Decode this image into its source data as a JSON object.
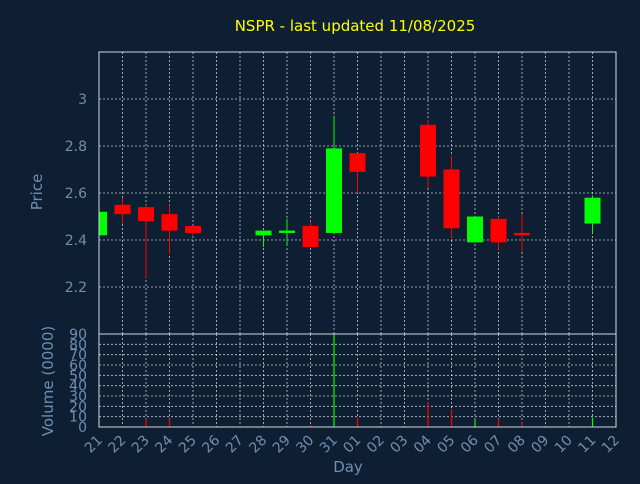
{
  "chart_data": {
    "type": "candlestick",
    "title": "NSPR - last updated 11/08/2025",
    "xlabel": "Day",
    "ylabel_price": "Price",
    "ylabel_volume": "Volume (0000)",
    "x_ticks": [
      "21",
      "22",
      "23",
      "24",
      "25",
      "26",
      "27",
      "28",
      "29",
      "30",
      "31",
      "01",
      "02",
      "03",
      "04",
      "05",
      "06",
      "07",
      "08",
      "09",
      "10",
      "11",
      "12"
    ],
    "price_ylim": [
      2.0,
      3.2
    ],
    "price_yticks": [
      2.2,
      2.4,
      2.6,
      2.8,
      3
    ],
    "volume_ylim": [
      0,
      90
    ],
    "volume_yticks": [
      0,
      10,
      20,
      30,
      40,
      50,
      60,
      70,
      80,
      90
    ],
    "grid": true,
    "colors": {
      "up": "#00ff00",
      "down": "#ff0000",
      "title": "#ffff00",
      "axis_text": "#6e8fb0",
      "grid": "#ffffff",
      "background": "#0f1f33"
    },
    "candles": [
      {
        "day": "21",
        "open": 2.42,
        "high": 2.52,
        "low": 2.42,
        "close": 2.52,
        "volume": 0
      },
      {
        "day": "22",
        "open": 2.55,
        "high": 2.58,
        "low": 2.47,
        "close": 2.51,
        "volume": 1
      },
      {
        "day": "23",
        "open": 2.54,
        "high": 2.55,
        "low": 2.24,
        "close": 2.48,
        "volume": 8
      },
      {
        "day": "24",
        "open": 2.51,
        "high": 2.55,
        "low": 2.34,
        "close": 2.44,
        "volume": 8
      },
      {
        "day": "25",
        "open": 2.46,
        "high": 2.46,
        "low": 2.42,
        "close": 2.43,
        "volume": 1
      },
      {
        "day": "28",
        "open": 2.42,
        "high": 2.44,
        "low": 2.37,
        "close": 2.44,
        "volume": 1
      },
      {
        "day": "29",
        "open": 2.43,
        "high": 2.49,
        "low": 2.38,
        "close": 2.44,
        "volume": 1
      },
      {
        "day": "30",
        "open": 2.46,
        "high": 2.48,
        "low": 2.37,
        "close": 2.37,
        "volume": 2
      },
      {
        "day": "31",
        "open": 2.43,
        "high": 2.93,
        "low": 2.43,
        "close": 2.79,
        "volume": 90
      },
      {
        "day": "01",
        "open": 2.77,
        "high": 2.77,
        "low": 2.6,
        "close": 2.69,
        "volume": 9
      },
      {
        "day": "04",
        "open": 2.89,
        "high": 2.91,
        "low": 2.62,
        "close": 2.67,
        "volume": 24
      },
      {
        "day": "05",
        "open": 2.7,
        "high": 2.76,
        "low": 2.41,
        "close": 2.45,
        "volume": 17
      },
      {
        "day": "06",
        "open": 2.39,
        "high": 2.5,
        "low": 2.39,
        "close": 2.5,
        "volume": 7
      },
      {
        "day": "07",
        "open": 2.49,
        "high": 2.5,
        "low": 2.36,
        "close": 2.39,
        "volume": 8
      },
      {
        "day": "08",
        "open": 2.43,
        "high": 2.51,
        "low": 2.35,
        "close": 2.42,
        "volume": 4
      },
      {
        "day": "11",
        "open": 2.47,
        "high": 2.59,
        "low": 2.43,
        "close": 2.58,
        "volume": 9
      }
    ]
  }
}
